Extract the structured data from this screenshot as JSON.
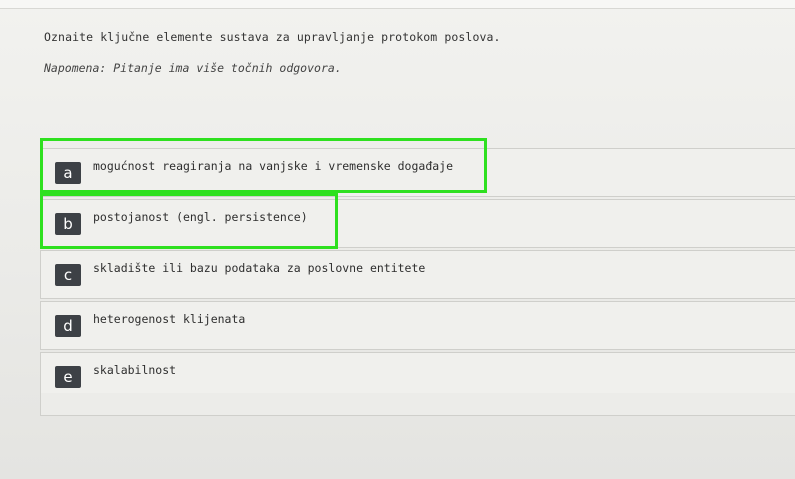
{
  "question": {
    "text": "Oznaite ključne elemente sustava za upravljanje protokom poslova.",
    "note": "Napomena: Pitanje ima više točnih odgovora."
  },
  "answers": [
    {
      "letter": "a",
      "text": "mogućnost reagiranja na vanjske i vremenske događaje",
      "highlighted": true
    },
    {
      "letter": "b",
      "text": "postojanost (engl. persistence)",
      "highlighted": true
    },
    {
      "letter": "c",
      "text": "skladište ili bazu podataka za poslovne entitete",
      "highlighted": false
    },
    {
      "letter": "d",
      "text": "heterogenost klijenata",
      "highlighted": false
    },
    {
      "letter": "e",
      "text": "skalabilnost",
      "highlighted": false
    }
  ],
  "colors": {
    "highlight": "#2ee01f",
    "letter_badge": "#3d4146"
  }
}
